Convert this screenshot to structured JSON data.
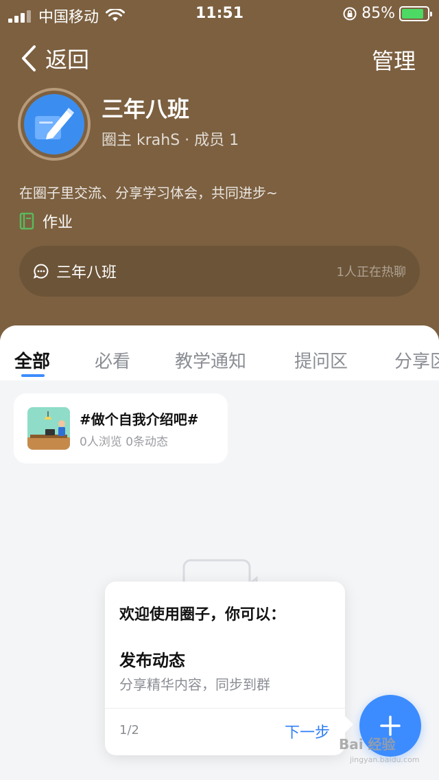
{
  "status_bar": {
    "carrier": "中国移动",
    "time": "11:51",
    "battery": "85%"
  },
  "nav": {
    "back_label": "返回",
    "manage_label": "管理"
  },
  "group": {
    "name": "三年八班",
    "meta": "圈主 krahS · 成员 1",
    "description": "在圈子里交流、分享学习体会，共同进步~",
    "tag": "作业",
    "chat_name": "三年八班",
    "chat_hint": "1人正在热聊"
  },
  "tabs": [
    {
      "label": "全部",
      "active": true
    },
    {
      "label": "必看",
      "active": false
    },
    {
      "label": "教学通知",
      "active": false
    },
    {
      "label": "提问区",
      "active": false
    },
    {
      "label": "分享区",
      "active": false
    }
  ],
  "topic": {
    "title": "#做个自我介绍吧#",
    "stats": "0人浏览 0条动态"
  },
  "popup": {
    "title": "欢迎使用圈子，你可以：",
    "feature": "发布动态",
    "subtitle": "分享精华内容，同步到群",
    "page": "1/2",
    "next_label": "下一步"
  },
  "watermark": {
    "text": "Bai 经验",
    "sub": "jingyan.baidu.com"
  },
  "colors": {
    "header_bg": "#7c6040",
    "accent": "#3c8cff",
    "tag_green": "#5cb85c"
  },
  "icons": [
    "signal-icon",
    "wifi-icon",
    "rotation-lock-icon",
    "battery-icon",
    "back-chevron-icon",
    "pencil-icon",
    "book-icon",
    "chat-bubble-icon",
    "plus-icon"
  ]
}
